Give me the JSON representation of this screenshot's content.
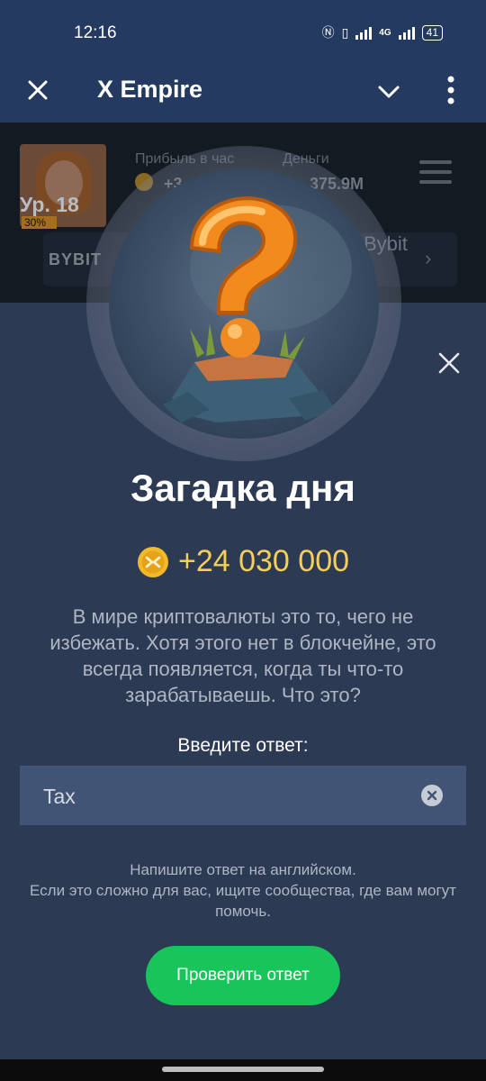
{
  "status_bar": {
    "time": "12:16",
    "network": "4G",
    "battery": "41"
  },
  "app_bar": {
    "title": "X Empire"
  },
  "background": {
    "level": "Ур. 18",
    "level_progress_label": "30%",
    "profit_label": "Прибыль в час",
    "money_label": "Деньги",
    "money_value": "375.9M",
    "profit_value": "+3",
    "banner_brand": "BYBIT",
    "banner_brand_right": "Bybit"
  },
  "riddle_sheet": {
    "title": "Загадка дня",
    "reward": "+24 030 000",
    "question": "В мире криптовалюты это то, чего не избежать. Хотя этого нет в блокчейне, это всегда появляется, когда ты что-то зарабатываешь. Что это?",
    "answer_label": "Введите ответ:",
    "answer_value": "Tax",
    "hint_line1": "Напишите ответ на английском.",
    "hint_line2": "Если это сложно для вас, ищите сообщества, где вам могут помочь.",
    "check_button": "Проверить ответ"
  },
  "colors": {
    "sheet_bg": "#2c3a54",
    "header_bg": "#243a60",
    "accent_green": "#17c55a",
    "reward_gold": "#f5cf58"
  }
}
